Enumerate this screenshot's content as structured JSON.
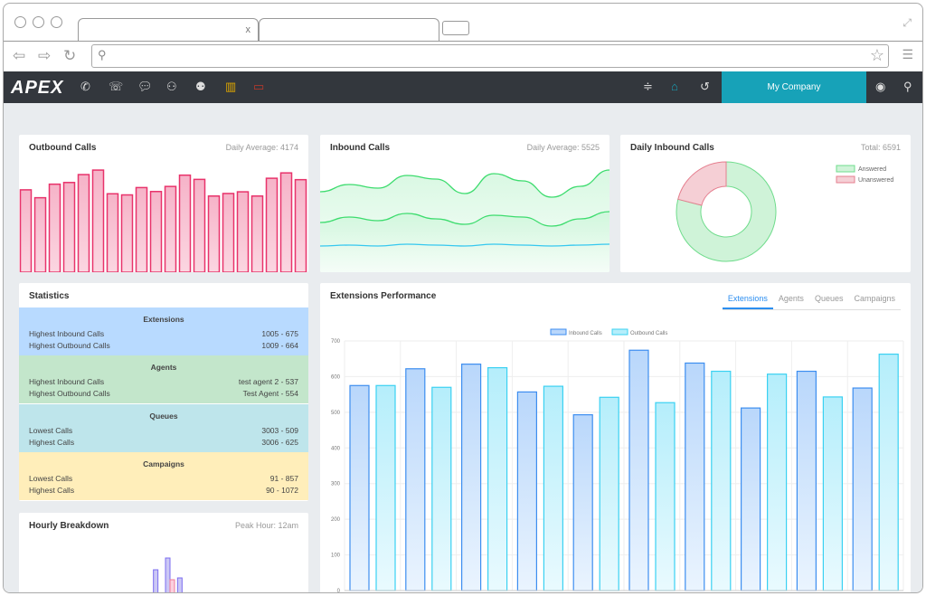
{
  "browser": {
    "tab_close": "x"
  },
  "appbar": {
    "logo": "APEX",
    "company": "My Company",
    "icons": [
      "phone-icon",
      "phone-forward-icon",
      "chat-icon",
      "conference-icon",
      "users-icon",
      "reports-icon",
      "monitor-icon",
      "sliders-icon",
      "inbox-icon",
      "history-icon",
      "account-icon",
      "search-icon"
    ],
    "accent": "#17a2b8"
  },
  "outbound": {
    "title": "Outbound Calls",
    "subtitle": "Daily Average: 4174",
    "color": "#e8336b",
    "chart_data": {
      "type": "bar",
      "values": [
        292,
        264,
        312,
        318,
        346,
        362,
        278,
        274,
        300,
        286,
        304,
        344,
        329,
        270,
        279,
        285,
        270,
        333,
        352,
        328
      ]
    }
  },
  "inbound": {
    "title": "Inbound Calls",
    "subtitle": "Daily Average: 5525",
    "chart_data": {
      "type": "area",
      "series": [
        {
          "color": "#3ddc6e",
          "values": [
            72,
            80,
            76,
            90,
            86,
            70,
            92,
            84,
            66,
            78,
            96
          ]
        },
        {
          "color": "#3ddc6e",
          "values": [
            38,
            44,
            40,
            48,
            42,
            36,
            46,
            44,
            34,
            42,
            50
          ]
        },
        {
          "color": "#36c8ef",
          "values": [
            12,
            13,
            12,
            14,
            13,
            12,
            14,
            13,
            12,
            13,
            14
          ]
        }
      ]
    }
  },
  "daily": {
    "title": "Daily Inbound Calls",
    "subtitle": "Total: 6591",
    "chart_data": {
      "type": "pie",
      "donut": true,
      "slices": [
        {
          "label": "Answered",
          "value": 79,
          "color": "#cff3d8",
          "stroke": "#6fdc8c"
        },
        {
          "label": "Unanswered",
          "value": 21,
          "color": "#f5cfd5",
          "stroke": "#e57f8f"
        }
      ],
      "legend": "top-right"
    }
  },
  "stats": {
    "title": "Statistics",
    "sections": [
      {
        "name": "Extensions",
        "color": "#b8daff",
        "rows": [
          [
            "Highest Inbound Calls",
            "1005 - 675"
          ],
          [
            "Highest Outbound Calls",
            "1009 - 664"
          ]
        ]
      },
      {
        "name": "Agents",
        "color": "#c3e6cb",
        "rows": [
          [
            "Highest Inbound Calls",
            "test agent 2 - 537"
          ],
          [
            "Highest Outbound Calls",
            "Test Agent - 554"
          ]
        ]
      },
      {
        "name": "Queues",
        "color": "#bee5eb",
        "rows": [
          [
            "Lowest Calls",
            "3003 - 509"
          ],
          [
            "Highest Calls",
            "3006 - 625"
          ]
        ]
      },
      {
        "name": "Campaigns",
        "color": "#ffeeba",
        "rows": [
          [
            "Lowest Calls",
            "91 - 857"
          ],
          [
            "Highest Calls",
            "90 - 1072"
          ]
        ]
      }
    ]
  },
  "hourly": {
    "title": "Hourly Breakdown",
    "subtitle": "Peak Hour: 12am",
    "chart_data": {
      "type": "bar",
      "series": [
        {
          "color": "#7b6cf0",
          "values": [
            0,
            0,
            0,
            0,
            0,
            0,
            0,
            0,
            0,
            0,
            0,
            36,
            49,
            27,
            0,
            0,
            0,
            0,
            0,
            0,
            0,
            0,
            0,
            0
          ]
        },
        {
          "color": "#ef7a9a",
          "values": [
            0,
            0,
            0,
            0,
            0,
            0,
            0,
            0,
            0,
            0,
            0,
            0,
            25,
            0,
            0,
            0,
            0,
            0,
            0,
            0,
            0,
            0,
            0,
            0
          ]
        }
      ]
    }
  },
  "perf": {
    "title": "Extensions Performance",
    "tabs": [
      "Extensions",
      "Agents",
      "Queues",
      "Campaigns"
    ],
    "active_tab": 0,
    "chart_data": {
      "type": "bar",
      "ylim": [
        0,
        700
      ],
      "yticks": [
        0,
        100,
        200,
        300,
        400,
        500,
        600,
        700
      ],
      "grid": true,
      "legend": "top",
      "series": [
        {
          "name": "Inbound Calls",
          "color": "#3d8ef0",
          "values": [
            575,
            622,
            635,
            557,
            493,
            674,
            638,
            512,
            615,
            568
          ]
        },
        {
          "name": "Outbound Calls",
          "color": "#3ad1f2",
          "values": [
            575,
            570,
            625,
            573,
            542,
            527,
            615,
            607,
            543,
            663
          ]
        }
      ]
    }
  }
}
